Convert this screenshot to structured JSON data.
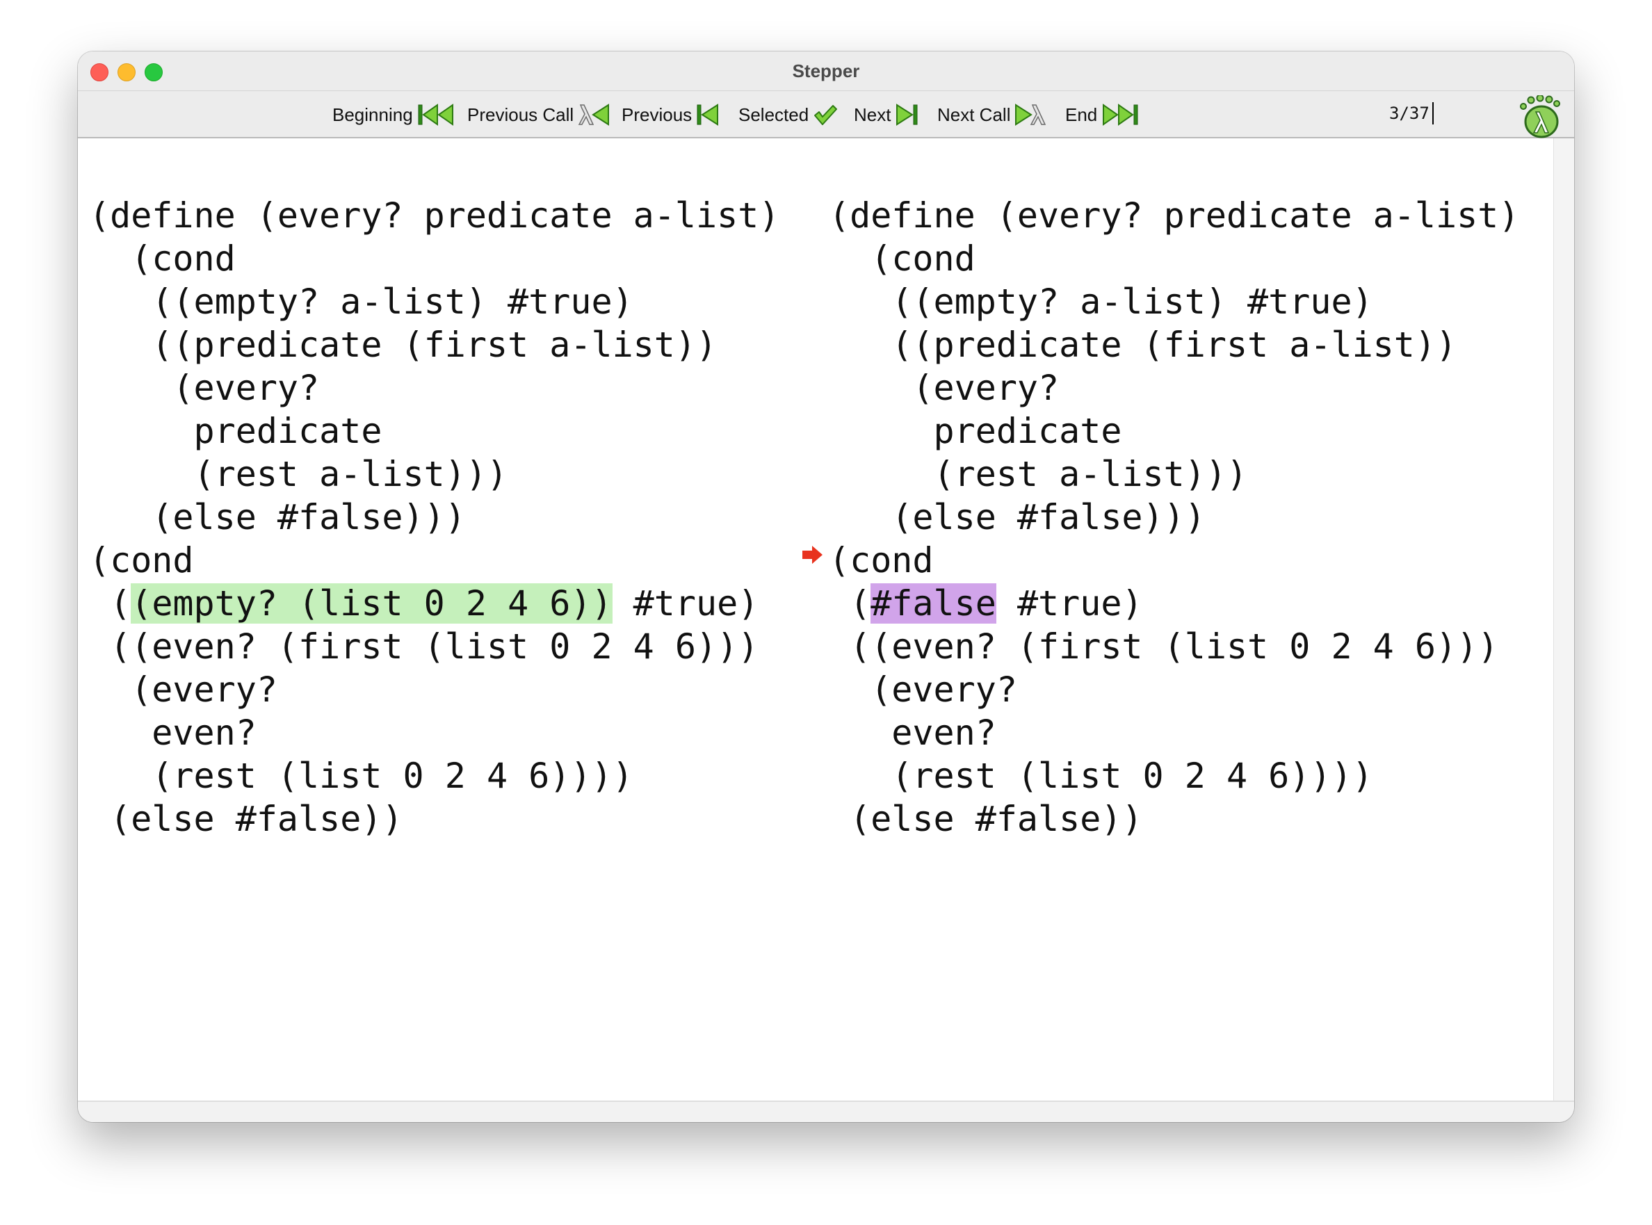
{
  "window": {
    "title": "Stepper"
  },
  "toolbar": {
    "beginning": "Beginning",
    "previous_call": "Previous Call",
    "previous": "Previous",
    "selected": "Selected",
    "next": "Next",
    "next_call": "Next Call",
    "end": "End",
    "step_counter": "3/37"
  },
  "left_pane": {
    "lines": [
      "(define (every? predicate a-list)",
      "  (cond",
      "   ((empty? a-list) #true)",
      "   ((predicate (first a-list))",
      "    (every?",
      "     predicate",
      "     (rest a-list)))",
      "   (else #false)))",
      "(cond",
      " ",
      " ((even? (first (list 0 2 4 6)))",
      "  (every?",
      "   even?",
      "   (rest (list 0 2 4 6))))",
      " (else #false))"
    ],
    "redex_prefix": " (",
    "redex_text": "(empty? (list 0 2 4 6))",
    "redex_suffix": " #true)"
  },
  "right_pane": {
    "lines": [
      "(define (every? predicate a-list)",
      "  (cond",
      "   ((empty? a-list) #true)",
      "   ((predicate (first a-list))",
      "    (every?",
      "     predicate",
      "     (rest a-list)))",
      "   (else #false)))",
      "(cond",
      " ",
      " ((even? (first (list 0 2 4 6)))",
      "  (every?",
      "   even?",
      "   (rest (list 0 2 4 6))))",
      " (else #false))"
    ],
    "result_prefix": " (",
    "result_text": "#false",
    "result_suffix": " #true)"
  },
  "colors": {
    "redex_highlight": "#c5f0bb",
    "result_highlight": "#d1a4ea",
    "step_arrow": "#e8321e"
  },
  "icons": {
    "beginning": "skip-to-beginning-icon",
    "previous_call": "lambda-back-icon",
    "previous": "step-back-icon",
    "selected": "checkmark-icon",
    "next": "step-forward-icon",
    "next_call": "lambda-forward-icon",
    "end": "skip-to-end-icon",
    "logo": "racket-footprint-logo",
    "step_arrow": "red-arrow-icon"
  }
}
